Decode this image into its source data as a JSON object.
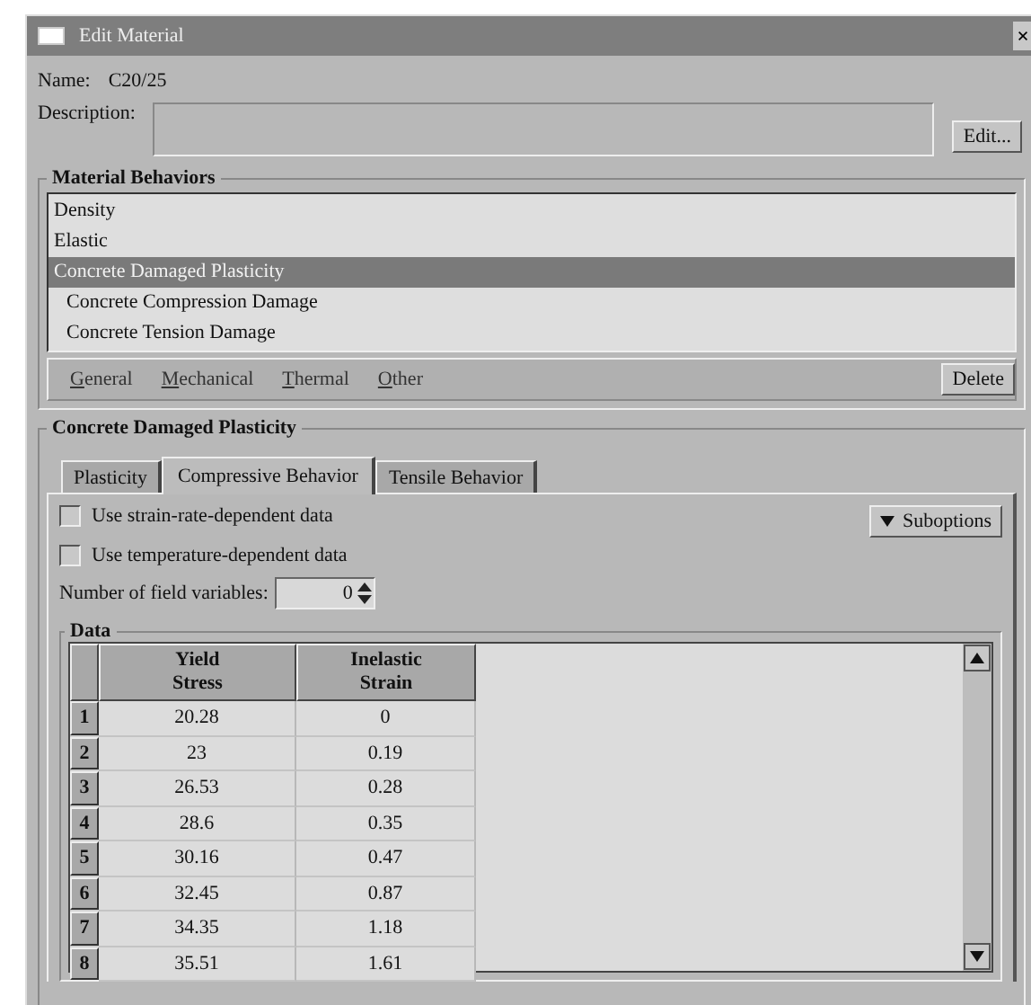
{
  "window": {
    "title": "Edit Material",
    "close": "×"
  },
  "name": {
    "label": "Name:",
    "value": "C20/25"
  },
  "description": {
    "label": "Description:",
    "button": "Edit..."
  },
  "material_behaviors": {
    "title": "Material Behaviors",
    "items": [
      {
        "label": "Density",
        "selected": false
      },
      {
        "label": "Elastic",
        "selected": false
      },
      {
        "label": "Concrete Damaged Plasticity",
        "selected": true,
        "children": [
          {
            "label": "Concrete Compression Damage",
            "selected": false
          },
          {
            "label": "Concrete Tension Damage",
            "selected": false
          }
        ]
      }
    ],
    "menus": [
      "General",
      "Mechanical",
      "Thermal",
      "Other"
    ],
    "delete": "Delete"
  },
  "behavior": {
    "title": "Concrete Damaged Plasticity",
    "tabs": [
      {
        "label": "Plasticity",
        "selected": false
      },
      {
        "label": "Compressive Behavior",
        "selected": true
      },
      {
        "label": "Tensile Behavior",
        "selected": false
      }
    ],
    "options": [
      {
        "label": "Use strain-rate-dependent data",
        "checked": false
      },
      {
        "label": "Use temperature-dependent data",
        "checked": false
      }
    ],
    "suboptions": "Suboptions",
    "field_variables": {
      "label": "Number of field variables:",
      "value": "0"
    },
    "data": {
      "title": "Data",
      "columns": [
        "Yield\nStress",
        "Inelastic\nStrain"
      ],
      "rows": [
        {
          "index": "1",
          "cells": [
            "20.28",
            "0"
          ]
        },
        {
          "index": "2",
          "cells": [
            "23",
            "0.19"
          ]
        },
        {
          "index": "3",
          "cells": [
            "26.53",
            "0.28"
          ]
        },
        {
          "index": "4",
          "cells": [
            "28.6",
            "0.35"
          ]
        },
        {
          "index": "5",
          "cells": [
            "30.16",
            "0.47"
          ]
        },
        {
          "index": "6",
          "cells": [
            "32.45",
            "0.87"
          ]
        },
        {
          "index": "7",
          "cells": [
            "34.35",
            "1.18"
          ]
        },
        {
          "index": "8",
          "cells": [
            "35.51",
            "1.61"
          ]
        }
      ]
    }
  }
}
